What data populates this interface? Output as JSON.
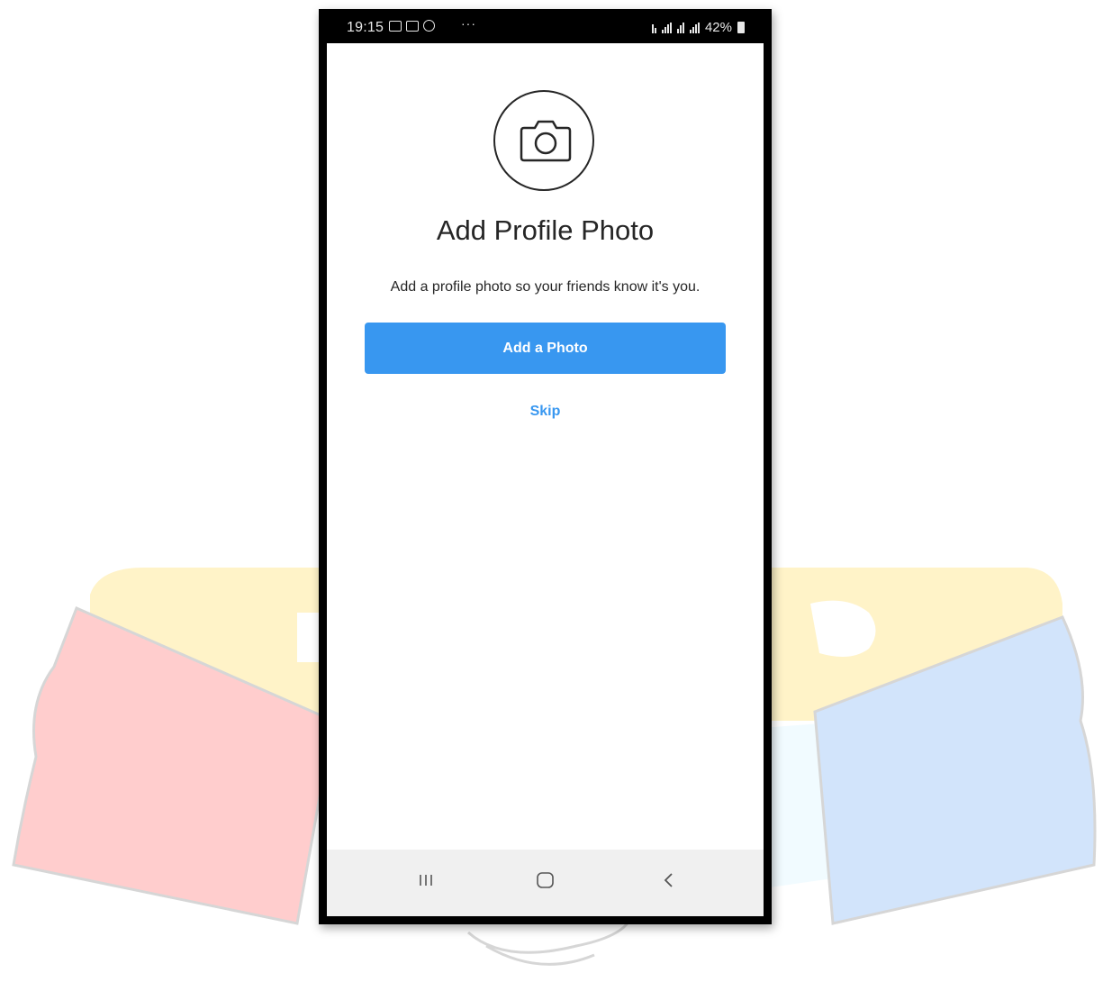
{
  "status_bar": {
    "time": "19:15",
    "more": "···",
    "battery": "42%"
  },
  "screen": {
    "title": "Add Profile Photo",
    "subtitle": "Add a profile photo so your friends know it's you.",
    "add_photo_label": "Add a Photo",
    "skip_label": "Skip",
    "accent_color": "#3897f0"
  },
  "icons": {
    "camera": "camera-icon",
    "nav_recents": "recents-icon",
    "nav_home": "home-icon",
    "nav_back": "back-icon"
  }
}
